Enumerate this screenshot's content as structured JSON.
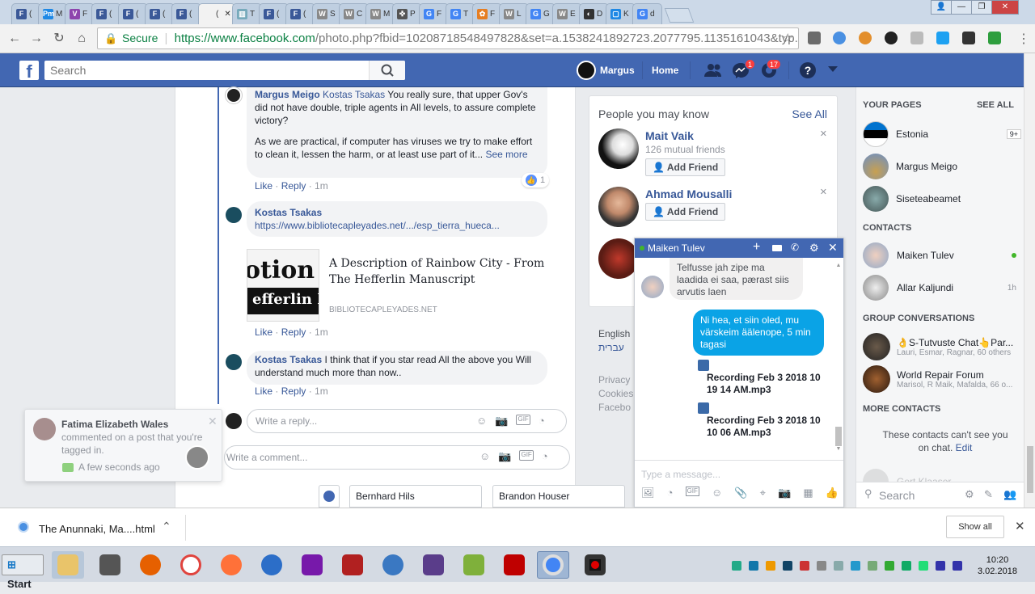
{
  "browser": {
    "tabs": [
      {
        "fav": "F",
        "color": "#3b5998",
        "text": "(",
        "icon": "facebook-icon"
      },
      {
        "fav": "Pm",
        "color": "#1e88e5",
        "text": "M",
        "icon": "pm-icon"
      },
      {
        "fav": "V",
        "color": "#8e44ad",
        "text": "F",
        "icon": "v-icon"
      },
      {
        "fav": "F",
        "color": "#3b5998",
        "text": "(",
        "icon": "facebook-icon"
      },
      {
        "fav": "F",
        "color": "#3b5998",
        "text": "(",
        "icon": "facebook-icon"
      },
      {
        "fav": "F",
        "color": "#3b5998",
        "text": "(",
        "icon": "facebook-icon"
      },
      {
        "fav": "F",
        "color": "#3b5998",
        "text": "(",
        "icon": "facebook-icon"
      },
      {
        "fav": "",
        "color": "#f2f2f2",
        "text": "(",
        "icon": "active-tab-icon"
      },
      {
        "fav": "▥",
        "color": "#7ab",
        "text": "T",
        "icon": "chart-icon"
      },
      {
        "fav": "F",
        "color": "#3b5998",
        "text": "(",
        "icon": "facebook-icon"
      },
      {
        "fav": "F",
        "color": "#3b5998",
        "text": "(",
        "icon": "facebook-icon"
      },
      {
        "fav": "W",
        "color": "#888",
        "text": "S",
        "icon": "wikipedia-icon"
      },
      {
        "fav": "W",
        "color": "#888",
        "text": "C",
        "icon": "wikipedia-icon"
      },
      {
        "fav": "W",
        "color": "#888",
        "text": "M",
        "icon": "wikipedia-icon"
      },
      {
        "fav": "✜",
        "color": "#555",
        "text": "P",
        "icon": "cross-icon"
      },
      {
        "fav": "G",
        "color": "#4285f4",
        "text": "F",
        "icon": "google-icon"
      },
      {
        "fav": "G",
        "color": "#4285f4",
        "text": "T",
        "icon": "google-icon"
      },
      {
        "fav": "✿",
        "color": "#e67e22",
        "text": "F",
        "icon": "flower-icon"
      },
      {
        "fav": "W",
        "color": "#888",
        "text": "L",
        "icon": "wikipedia-icon"
      },
      {
        "fav": "G",
        "color": "#4285f4",
        "text": "G",
        "icon": "translate-icon"
      },
      {
        "fav": "W",
        "color": "#888",
        "text": "E",
        "icon": "wikipedia-icon"
      },
      {
        "fav": "◐",
        "color": "#333",
        "text": "D",
        "icon": "dark-icon"
      },
      {
        "fav": "▢",
        "color": "#1e88e5",
        "text": "K",
        "icon": "box-icon"
      },
      {
        "fav": "G",
        "color": "#4285f4",
        "text": "d",
        "icon": "google-icon"
      }
    ],
    "secure_label": "Secure",
    "url_host": "https://www.facebook.com",
    "url_path": "/photo.php?fbid=10208718548497828&set=a.1538241892723.2077795.1135161043&typ..."
  },
  "fb": {
    "search_placeholder": "Search",
    "user_name": "Margus",
    "home": "Home",
    "messages_badge": "1",
    "notif_badge": "17"
  },
  "feed": {
    "comment1": {
      "author": "Margus Meigo",
      "mention": "Kostas Tsakas",
      "text": " You really sure, that upper Gov's did not have double, triple agents in All levels, to assure complete victory?",
      "text2": "As we are practical, if computer has viruses we try to make effort to clean it, lessen the harm, or at least use part of it...",
      "see_more": "See more",
      "reactions": "1"
    },
    "actions": {
      "like": "Like",
      "reply": "Reply",
      "time": "1m"
    },
    "comment2": {
      "author": "Kostas Tsakas",
      "link": "https://www.bibliotecapleyades.net/.../esp_tierra_hueca...",
      "preview_title": "A Description of Rainbow City - From The Hefferlin Manuscript",
      "preview_domain": "BIBLIOTECAPLEYADES.NET",
      "thumb_text_top": "otion o",
      "thumb_text_bot": "efferlin Ma"
    },
    "comment3": {
      "author": "Kostas Tsakas",
      "text": " I think that if you star read All the above you Will understand much more than now.."
    },
    "reply_placeholder": "Write a reply...",
    "comment_placeholder": "Write a comment..."
  },
  "pymk": {
    "title": "People you may know",
    "see_all": "See All",
    "people": [
      {
        "name": "Mait Vaik",
        "mutual": "126 mutual friends",
        "button": "Add Friend"
      },
      {
        "name": "Ahmad Mousalli",
        "mutual": "",
        "button": "Add Friend"
      }
    ],
    "lang_english": "English",
    "lang_hebrew": "עברית",
    "footer1": "Privacy",
    "footer2": "Cookies",
    "footer3": "Facebo"
  },
  "sidebar": {
    "your_pages": "YOUR PAGES",
    "see_all": "SEE ALL",
    "pages": [
      {
        "name": "Estonia",
        "extra": "9+"
      },
      {
        "name": "Margus Meigo",
        "extra": ""
      },
      {
        "name": "Siseteabeamet",
        "extra": ""
      }
    ],
    "contacts": "CONTACTS",
    "contact_list": [
      {
        "name": "Maiken Tulev",
        "status": "online"
      },
      {
        "name": "Allar Kaljundi",
        "status": "1h"
      }
    ],
    "group_conversations": "GROUP CONVERSATIONS",
    "groups": [
      {
        "name": "👌S-Tutvuste Chat👆Par...",
        "members": "Lauri, Esmar, Ragnar, 60 others"
      },
      {
        "name": "World Repair Forum",
        "members": "Marisol, R Maik, Mafalda, 66 o..."
      }
    ],
    "more_contacts": "MORE CONTACTS",
    "more_text": "These contacts can't see you on chat.",
    "edit": "Edit",
    "faded_name": "Gert Klaaser",
    "search_placeholder": "Search"
  },
  "chat": {
    "name": "Maiken Tulev",
    "in_msg": "Telfusse jah zipe ma laadida ei saa, pærast siis arvutis laen",
    "out_msg": "Ni hea, et siin oled, mu värskeim äälenope, 5 min tagasi",
    "file1": "Recording Feb 3 2018 10 19 14 AM.mp3",
    "file2": "Recording Feb 3 2018 10 10 06 AM.mp3",
    "input_placeholder": "Type a message..."
  },
  "notification": {
    "name": "Fatima Elizabeth Wales",
    "text": "commented on a post that you're tagged in.",
    "time": "A few seconds ago"
  },
  "chat_tabs": {
    "tab1": "Bernhard Hils",
    "tab2": "Brandon Houser"
  },
  "download": {
    "file": "The Anunnaki, Ma....html",
    "show_all": "Show all"
  },
  "taskbar": {
    "start": "Start",
    "time": "10:20",
    "date": "3.02.2018"
  }
}
